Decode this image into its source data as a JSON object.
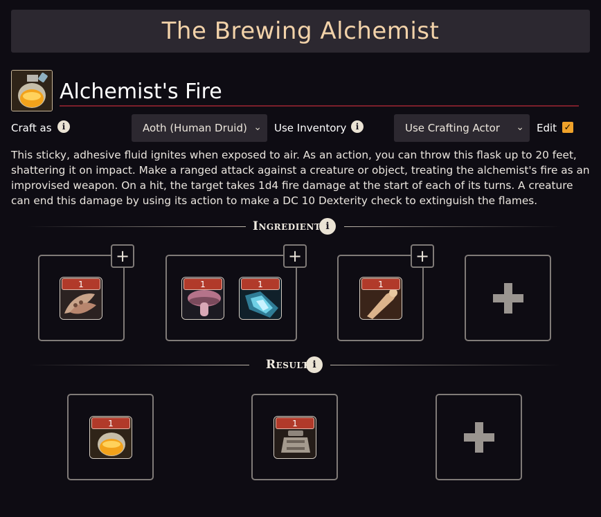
{
  "app": {
    "title": "The Brewing Alchemist"
  },
  "recipe": {
    "name": "Alchemist's Fire",
    "description": "This sticky, adhesive fluid ignites when exposed to air. As an action, you can throw this flask up to 20 feet, shattering it on impact. Make a ranged attack against a creature or object, treating the alchemist's fire as an improvised weapon. On a hit, the target takes 1d4 fire damage at the start of each of its turns. A creature can end this damage by using its action to make a DC 10 Dexterity check to extinguish the flames."
  },
  "controls": {
    "craft_as_label": "Craft as",
    "craft_as_value": "Aoth (Human Druid)",
    "use_inventory_label": "Use Inventory",
    "use_inventory_value": "Use Crafting Actor",
    "edit_label": "Edit",
    "edit_checked": true,
    "info_glyph": "i",
    "check_glyph": "✓",
    "chevron_glyph": "⌄"
  },
  "ingredients": {
    "title": "Ingredients",
    "groups": [
      {
        "items": [
          {
            "qty": "1",
            "icon": "bean-pod-icon"
          }
        ],
        "add_glyph": "+"
      },
      {
        "items": [
          {
            "qty": "1",
            "icon": "mushroom-icon"
          },
          {
            "qty": "1",
            "icon": "blue-crystal-icon"
          }
        ],
        "add_glyph": "+"
      },
      {
        "items": [
          {
            "qty": "1",
            "icon": "bone-icon"
          }
        ],
        "add_glyph": "+"
      }
    ]
  },
  "result": {
    "title": "Result",
    "items": [
      {
        "qty": "1",
        "icon": "orange-potion-icon"
      },
      {
        "qty": "1",
        "icon": "iron-flask-icon"
      }
    ]
  },
  "colors": {
    "title_text": "#f2d2a9",
    "accent_underline": "#7c1f2b",
    "checkbox": "#f0a22a",
    "qty_badge": "#b13a2a",
    "slot_border": "#807b78"
  }
}
